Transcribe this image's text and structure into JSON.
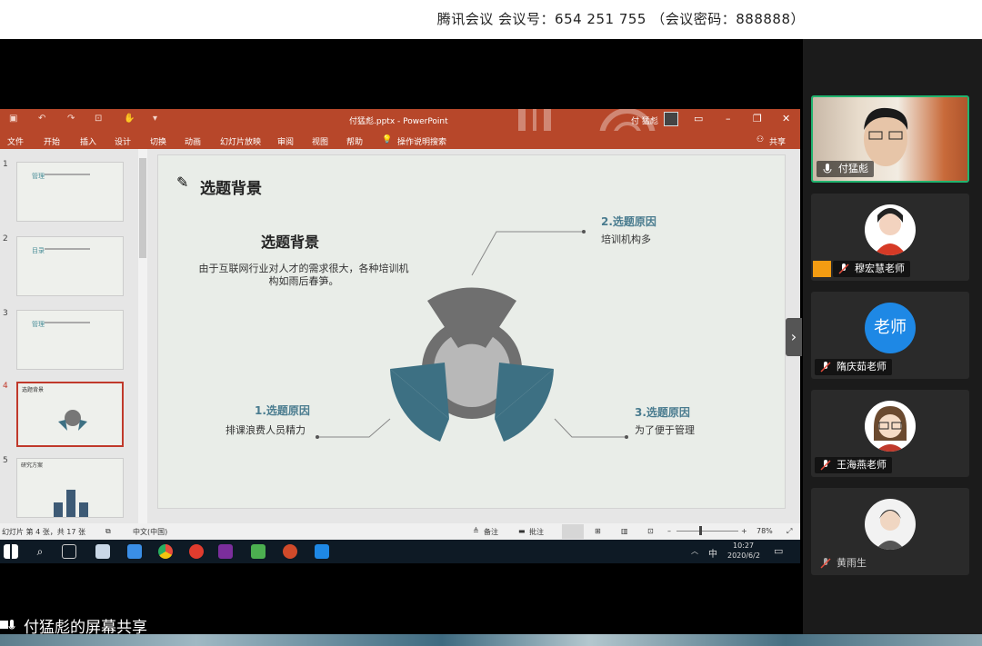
{
  "meeting": {
    "info": "腾讯会议 会议号：654 251 755 （会议密码：888888）"
  },
  "share_label": "付猛彪的屏幕共享",
  "ppt": {
    "doc_title": "付猛彪.pptx - PowerPoint",
    "user": "付 猛彪",
    "menu": [
      "文件",
      "开始",
      "插入",
      "设计",
      "切换",
      "动画",
      "幻灯片放映",
      "审阅",
      "视图",
      "帮助",
      "操作说明搜索",
      "共享"
    ],
    "thumb_numbers": [
      "1",
      "2",
      "3",
      "4",
      "5"
    ],
    "thumb_titles": [
      "管理",
      "目录",
      "管理",
      "选题背景",
      "研究方案"
    ],
    "slide": {
      "header": "选题背景",
      "subtitle": "选题背景",
      "paragraph": "由于互联网行业对人才的需求很大，各种培训机构如雨后春笋。",
      "r1_title": "1.选题原因",
      "r1_desc": "排课浪费人员精力",
      "r2_title": "2.选题原因",
      "r2_desc": "培训机构多",
      "r3_title": "3.选题原因",
      "r3_desc": "为了便于管理"
    },
    "status": {
      "slide_count": "幻灯片 第 4 张，共 17 张",
      "lang": "中文(中国)",
      "notes": "备注",
      "comments": "批注",
      "zoom": "78%"
    },
    "taskbar": {
      "ime": "中",
      "time": "10:27",
      "date": "2020/6/2"
    }
  },
  "participants": [
    {
      "name": "付猛彪"
    },
    {
      "name": "穆宏慧老师"
    },
    {
      "name": "隋庆茹老师",
      "avatar_text": "老师"
    },
    {
      "name": "王海燕老师"
    },
    {
      "name": "黄雨生"
    }
  ],
  "colors": {
    "accent_green": "#21b36f",
    "ppt_red": "#b7472a",
    "teal": "#4a7c8f"
  }
}
